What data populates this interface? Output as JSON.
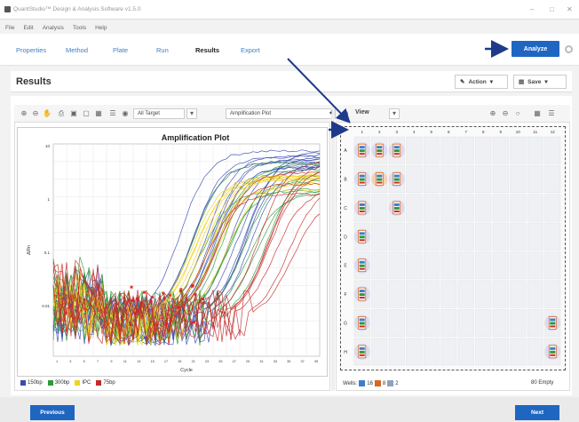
{
  "app": {
    "title": "QuantStudio™ Design & Analysis Software v1.5.0",
    "window_controls": [
      "–",
      "□",
      "✕"
    ]
  },
  "menu": [
    "File",
    "Edit",
    "Analysis",
    "Tools",
    "Help"
  ],
  "tabs": [
    "Properties",
    "Method",
    "Plate",
    "Run",
    "Results",
    "Export"
  ],
  "active_tab": "Results",
  "analyze_label": "Analyze",
  "results": {
    "title": "Results",
    "action_label": "Action",
    "save_label": "Save"
  },
  "left_toolbar": {
    "target_label": "All Target",
    "plot_type_label": "Amplification Plot"
  },
  "right_toolbar": {
    "view_label": "View"
  },
  "plot": {
    "title": "Amplification Plot",
    "ylabel": "ΔRn",
    "xlabel": "Cycle",
    "y_ticks": [
      "10",
      "1",
      "0.1",
      "0.01"
    ],
    "x_ticks": [
      "1",
      "3",
      "5",
      "7",
      "9",
      "11",
      "13",
      "15",
      "17",
      "19",
      "21",
      "23",
      "25",
      "27",
      "29",
      "31",
      "33",
      "35",
      "37",
      "39"
    ]
  },
  "legend": [
    {
      "label": "150bp",
      "color": "#3a4bb3"
    },
    {
      "label": "300bp",
      "color": "#2e9a3a"
    },
    {
      "label": "IPC",
      "color": "#f2d21a"
    },
    {
      "label": "75bp",
      "color": "#c62a2a"
    }
  ],
  "plate": {
    "cols": [
      "1",
      "2",
      "3",
      "4",
      "5",
      "6",
      "7",
      "8",
      "9",
      "10",
      "11",
      "12"
    ],
    "rows": [
      "A",
      "B",
      "C",
      "D",
      "E",
      "F",
      "G",
      "H"
    ]
  },
  "wells_summary": {
    "label": "Wells:",
    "counts": [
      "16",
      "8",
      "2"
    ],
    "colors": [
      "#3f7fc7",
      "#d9651f",
      "#8aa2c0"
    ],
    "empty_text": "80 Empty"
  },
  "nav": {
    "previous_label": "Previous",
    "next_label": "Next"
  },
  "colors": {
    "accent": "#1f66c1"
  }
}
